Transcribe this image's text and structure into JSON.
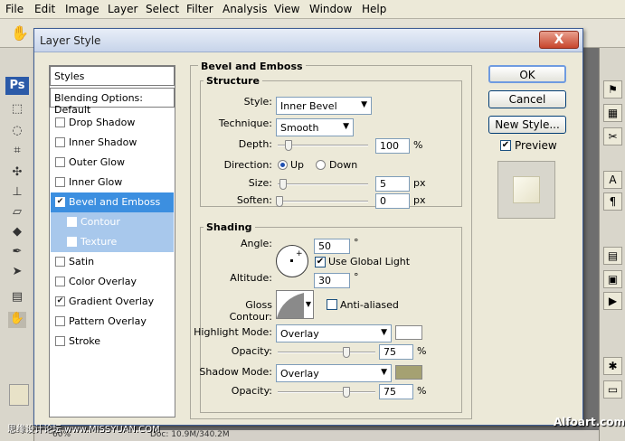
{
  "app": {
    "menu": [
      "File",
      "Edit",
      "Image",
      "Layer",
      "Select",
      "Filter",
      "Analysis",
      "View",
      "Window",
      "Help"
    ],
    "logo": "Ps",
    "status": "Doc: 10.9M/340.2M",
    "zoom": "60%"
  },
  "dialog": {
    "title": "Layer Style",
    "close": "X",
    "styles_list": {
      "header": "Styles",
      "blending": "Blending Options: Default",
      "items": [
        {
          "label": "Drop Shadow",
          "checked": false
        },
        {
          "label": "Inner Shadow",
          "checked": false
        },
        {
          "label": "Outer Glow",
          "checked": false
        },
        {
          "label": "Inner Glow",
          "checked": false
        },
        {
          "label": "Bevel and Emboss",
          "checked": true,
          "selected": true
        },
        {
          "label": "Contour",
          "checked": false,
          "sub": true
        },
        {
          "label": "Texture",
          "checked": false,
          "sub": true
        },
        {
          "label": "Satin",
          "checked": false
        },
        {
          "label": "Color Overlay",
          "checked": false
        },
        {
          "label": "Gradient Overlay",
          "checked": true
        },
        {
          "label": "Pattern Overlay",
          "checked": false
        },
        {
          "label": "Stroke",
          "checked": false
        }
      ]
    },
    "bevel": {
      "title": "Bevel and Emboss",
      "structure_title": "Structure",
      "style_label": "Style:",
      "style_value": "Inner Bevel",
      "technique_label": "Technique:",
      "technique_value": "Smooth",
      "depth_label": "Depth:",
      "depth_value": "100",
      "depth_unit": "%",
      "direction_label": "Direction:",
      "up_label": "Up",
      "down_label": "Down",
      "size_label": "Size:",
      "size_value": "5",
      "size_unit": "px",
      "soften_label": "Soften:",
      "soften_value": "0",
      "soften_unit": "px"
    },
    "shading": {
      "title": "Shading",
      "angle_label": "Angle:",
      "angle_value": "50",
      "degree": "°",
      "global_light_label": "Use Global Light",
      "altitude_label": "Altitude:",
      "altitude_value": "30",
      "gloss_label": "Gloss Contour:",
      "anti_aliased_label": "Anti-aliased",
      "highlight_mode_label": "Highlight Mode:",
      "highlight_mode_value": "Overlay",
      "highlight_color": "#ffffff",
      "opacity_label": "Opacity:",
      "highlight_opacity": "75",
      "opacity_unit": "%",
      "shadow_mode_label": "Shadow Mode:",
      "shadow_mode_value": "Overlay",
      "shadow_color": "#a5a172",
      "shadow_opacity": "75"
    },
    "buttons": {
      "ok": "OK",
      "cancel": "Cancel",
      "new_style": "New Style...",
      "preview_label": "Preview"
    }
  },
  "watermarks": {
    "left": "思缘设计论坛 www.MISSYUAN.COM",
    "right": "Alfoart.com"
  }
}
